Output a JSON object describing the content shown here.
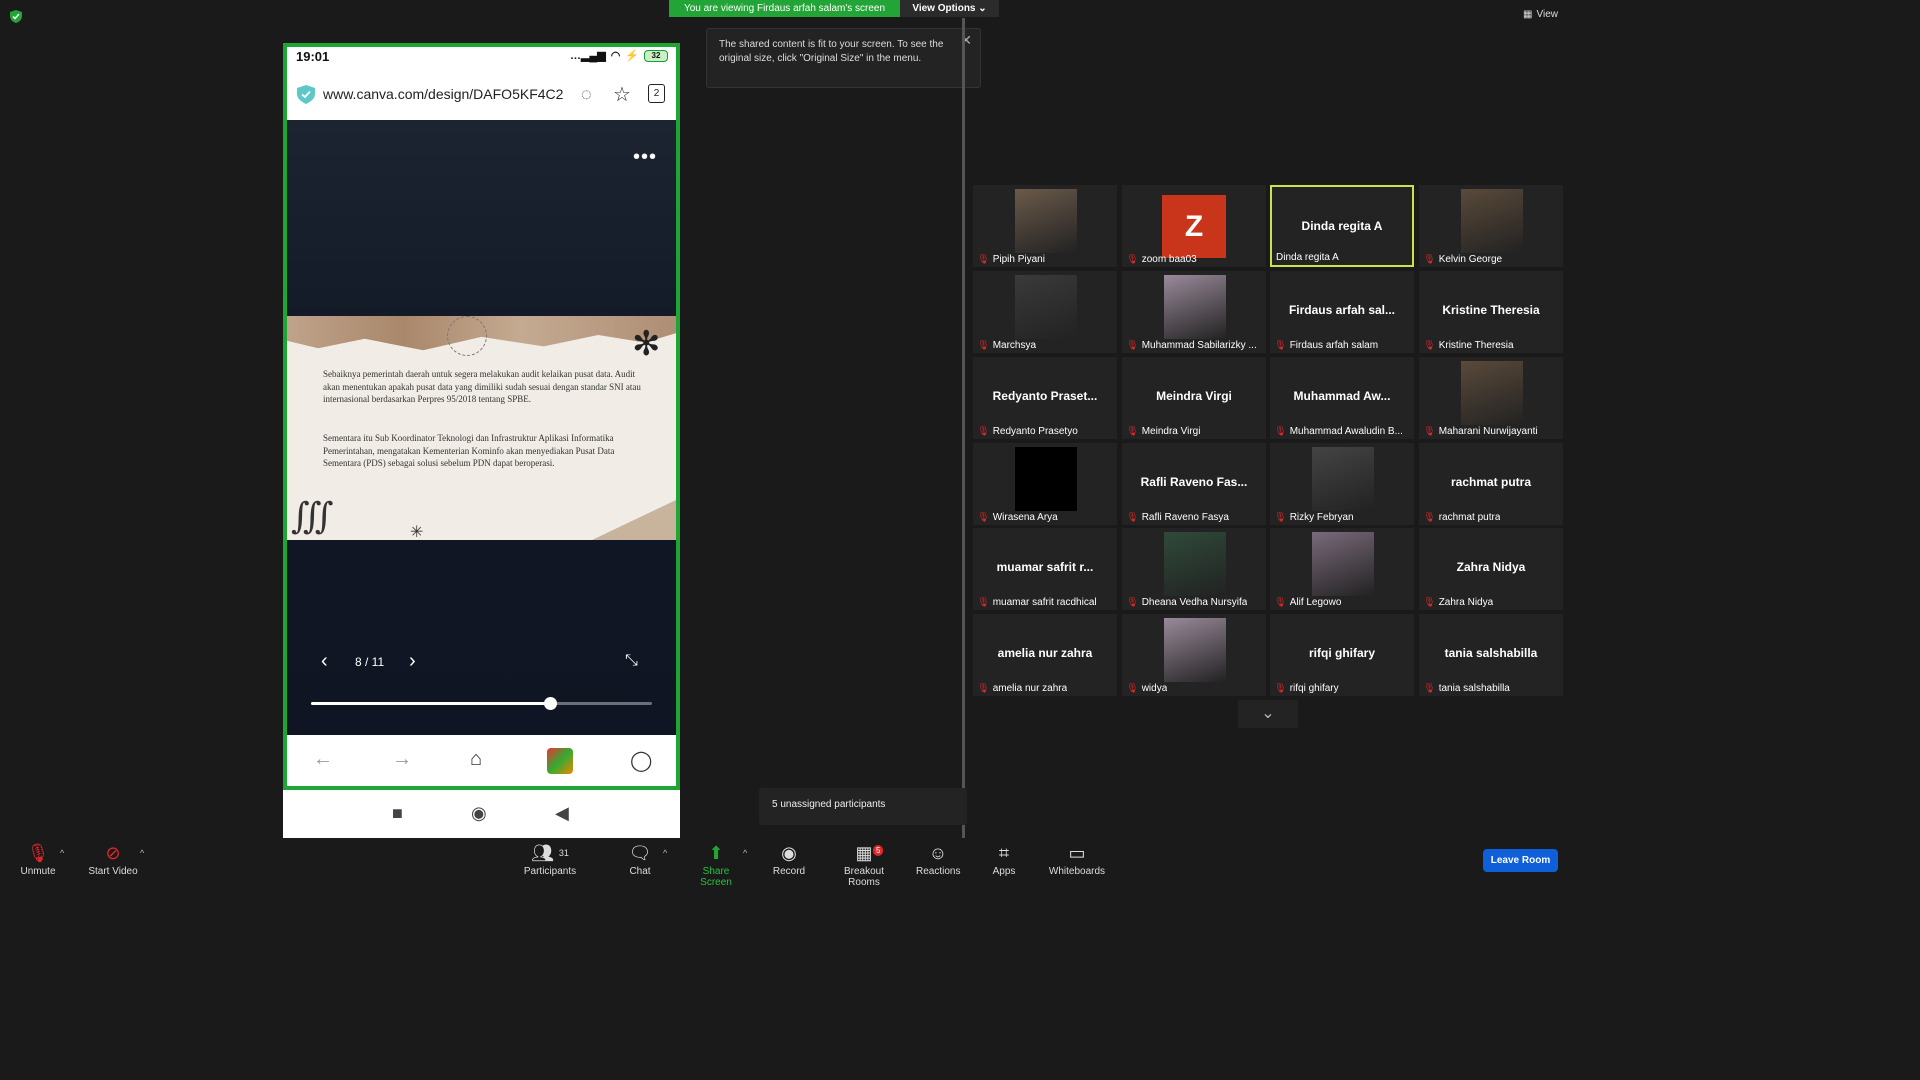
{
  "banner": {
    "viewing_text": "You are viewing Firdaus arfah salam's screen",
    "view_options": "View Options"
  },
  "top_right": {
    "view_label": "View"
  },
  "tooltip": {
    "text": "The shared content is fit to your screen. To see the original size, click \"Original Size\" in the menu."
  },
  "phone": {
    "time": "19:01",
    "battery": "32",
    "url": "www.canva.com/design/DAFO5KF4C2",
    "tab_count": "2",
    "slide_para1": "Sebaiknya pemerintah daerah untuk segera melakukan audit kelaikan pusat data. Audit akan menentukan apakah pusat data yang dimiliki sudah sesuai dengan standar SNI atau internasional berdasarkan Perpres 95/2018 tentang SPBE.",
    "slide_para2": "Sementara itu Sub Koordinator Teknologi dan Infrastruktur Aplikasi Informatika Pemerintahan, mengatakan Kementerian Kominfo akan menyediakan Pusat Data Sementara (PDS) sebagai solusi sebelum PDN dapat beroperasi.",
    "page_indicator": "8 / 11",
    "progress": 0.7
  },
  "participants_grid": [
    {
      "big": "",
      "label": "Pipih Piyani",
      "media": "photo"
    },
    {
      "big": "",
      "label": "zoom baa03",
      "media": "avatar-z"
    },
    {
      "big": "Dinda regita A",
      "label": "Dinda regita A",
      "active": true
    },
    {
      "big": "",
      "label": "Kelvin George",
      "media": "photo"
    },
    {
      "big": "",
      "label": "Marchsya",
      "media": "photo"
    },
    {
      "big": "",
      "label": "Muhammad Sabilarizky ...",
      "media": "photo"
    },
    {
      "big": "Firdaus arfah sal...",
      "label": "Firdaus arfah salam"
    },
    {
      "big": "Kristine Theresia",
      "label": "Kristine Theresia"
    },
    {
      "big": "Redyanto Praset...",
      "label": "Redyanto Prasetyo"
    },
    {
      "big": "Meindra Virgi",
      "label": "Meindra Virgi"
    },
    {
      "big": "Muhammad Aw...",
      "label": "Muhammad Awaludin B..."
    },
    {
      "big": "",
      "label": "Maharani Nurwijayanti",
      "media": "photo"
    },
    {
      "big": "",
      "label": "Wirasena Arya",
      "media": "black"
    },
    {
      "big": "Rafli Raveno Fas...",
      "label": "Rafli Raveno Fasya"
    },
    {
      "big": "",
      "label": "Rizky Febryan",
      "media": "photo"
    },
    {
      "big": "rachmat putra",
      "label": "rachmat putra"
    },
    {
      "big": "muamar safrit r...",
      "label": "muamar safrit racdhical"
    },
    {
      "big": "",
      "label": "Dheana Vedha Nursyifa",
      "media": "photo"
    },
    {
      "big": "",
      "label": "Alif Legowo",
      "media": "photo"
    },
    {
      "big": "Zahra Nidya",
      "label": "Zahra Nidya"
    },
    {
      "big": "amelia nur zahra",
      "label": "amelia nur zahra"
    },
    {
      "big": "",
      "label": "widya",
      "media": "photo"
    },
    {
      "big": "rifqi ghifary",
      "label": "rifqi ghifary"
    },
    {
      "big": "tania salshabilla",
      "label": "tania salshabilla"
    }
  ],
  "unassigned": "5 unassigned participants",
  "toolbar": {
    "unmute": "Unmute",
    "start_video": "Start Video",
    "participants": "Participants",
    "participants_count": "31",
    "chat": "Chat",
    "share_screen": "Share Screen",
    "record": "Record",
    "breakout_rooms": "Breakout Rooms",
    "breakout_count": "5",
    "reactions": "Reactions",
    "apps": "Apps",
    "whiteboards": "Whiteboards",
    "leave_room": "Leave Room"
  },
  "colors": {
    "share_green": "#23a436",
    "active_tile": "#cbe24a",
    "leave_blue": "#0e5fd8",
    "muted_red": "#e02828"
  }
}
